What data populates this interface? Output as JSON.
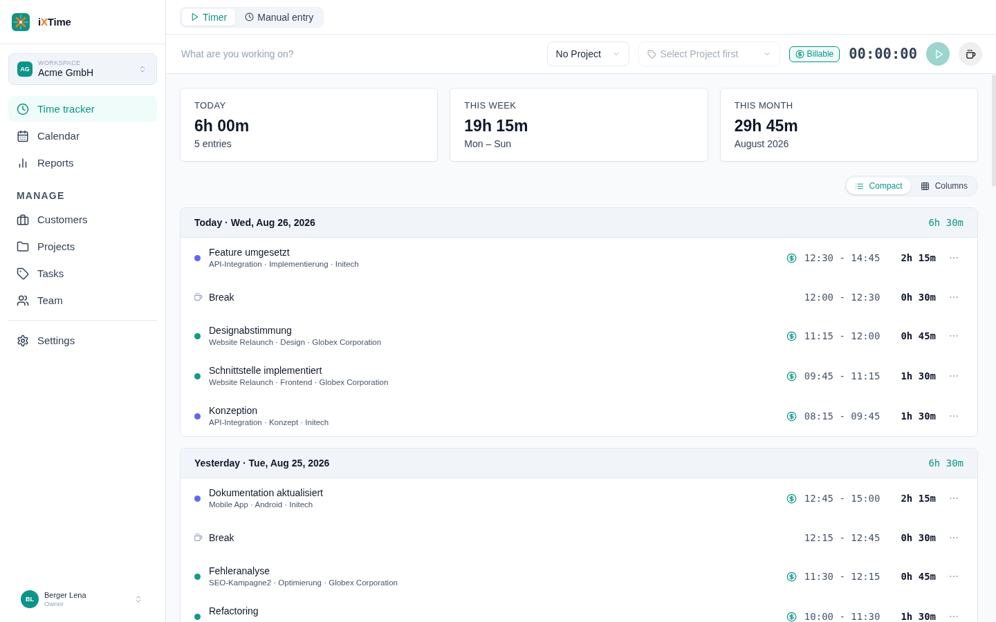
{
  "brand": {
    "parts": [
      {
        "text": "i",
        "accent": false
      },
      {
        "text": "X",
        "accent": true
      },
      {
        "text": "Time",
        "accent": false
      }
    ]
  },
  "workspace": {
    "label": "WORKSPACE",
    "initials": "AG",
    "name": "Acme GmbH"
  },
  "sidebar": {
    "nav": [
      {
        "label": "Time tracker",
        "selected": true
      },
      {
        "label": "Calendar",
        "selected": false
      },
      {
        "label": "Reports",
        "selected": false
      }
    ],
    "manage_heading": "MANAGE",
    "manage": [
      {
        "label": "Customers",
        "selected": false
      },
      {
        "label": "Projects",
        "selected": false
      },
      {
        "label": "Tasks",
        "selected": false
      },
      {
        "label": "Team",
        "selected": false
      }
    ],
    "settings": {
      "label": "Settings",
      "selected": false
    }
  },
  "user": {
    "initials": "BL",
    "name": "Berger Lena",
    "role": "Owner"
  },
  "mode_tabs": [
    {
      "label": "Timer",
      "selected": true
    },
    {
      "label": "Manual entry",
      "selected": false
    }
  ],
  "timer_bar": {
    "description": {
      "placeholder": "What are you working on?"
    },
    "project": {
      "value": "No Project"
    },
    "task": {
      "placeholder": "Select Project first",
      "disabled": true
    },
    "billable": {
      "label": "Billable",
      "on": true
    },
    "elapsed": "00:00:00",
    "start": {
      "disabled": true
    }
  },
  "stats": [
    {
      "label": "TODAY",
      "value": "6h 00m",
      "detail": "5 entries"
    },
    {
      "label": "THIS WEEK",
      "value": "19h 15m",
      "detail": "Mon – Sun"
    },
    {
      "label": "THIS MONTH",
      "value": "29h 45m",
      "detail": "August 2026"
    }
  ],
  "view_toggle": [
    {
      "label": "Compact",
      "selected": true
    },
    {
      "label": "Columns",
      "selected": false
    }
  ],
  "days": [
    {
      "title": "Today · Wed, Aug 26, 2026",
      "total": "6h 30m",
      "entries": [
        {
          "kind": "entry",
          "title": "Feature umgesetzt",
          "details": "API-Integration · Implementierung · Initech",
          "color": "#6366f1",
          "billable": true,
          "range": "12:30 - 14:45",
          "duration": "2h 15m"
        },
        {
          "kind": "break",
          "title": "Break",
          "billable": false,
          "range": "12:00 - 12:30",
          "duration": "0h 30m"
        },
        {
          "kind": "entry",
          "title": "Designabstimmung",
          "details": "Website Relaunch · Design · Globex Corporation",
          "color": "#12998a",
          "billable": true,
          "range": "11:15 - 12:00",
          "duration": "0h 45m"
        },
        {
          "kind": "entry",
          "title": "Schnittstelle implementiert",
          "details": "Website Relaunch · Frontend · Globex Corporation",
          "color": "#12998a",
          "billable": true,
          "range": "09:45 - 11:15",
          "duration": "1h 30m"
        },
        {
          "kind": "entry",
          "title": "Konzeption",
          "details": "API-Integration · Konzept · Initech",
          "color": "#6366f1",
          "billable": true,
          "range": "08:15 - 09:45",
          "duration": "1h 30m"
        }
      ]
    },
    {
      "title": "Yesterday · Tue, Aug 25, 2026",
      "total": "6h 30m",
      "entries": [
        {
          "kind": "entry",
          "title": "Dokumentation aktualisiert",
          "details": "Mobile App · Android · Initech",
          "color": "#6366f1",
          "billable": true,
          "range": "12:45 - 15:00",
          "duration": "2h 15m"
        },
        {
          "kind": "break",
          "title": "Break",
          "billable": false,
          "range": "12:15 - 12:45",
          "duration": "0h 30m"
        },
        {
          "kind": "entry",
          "title": "Fehleranalyse",
          "details": "SEO-Kampagne2 · Optimierung · Globex Corporation",
          "color": "#12998a",
          "billable": true,
          "range": "11:30 - 12:15",
          "duration": "0h 45m"
        },
        {
          "kind": "entry",
          "title": "Refactoring",
          "color": "#12998a",
          "billable": true,
          "range": "10:00 - 11:30",
          "duration": "1h 30m"
        }
      ]
    }
  ]
}
